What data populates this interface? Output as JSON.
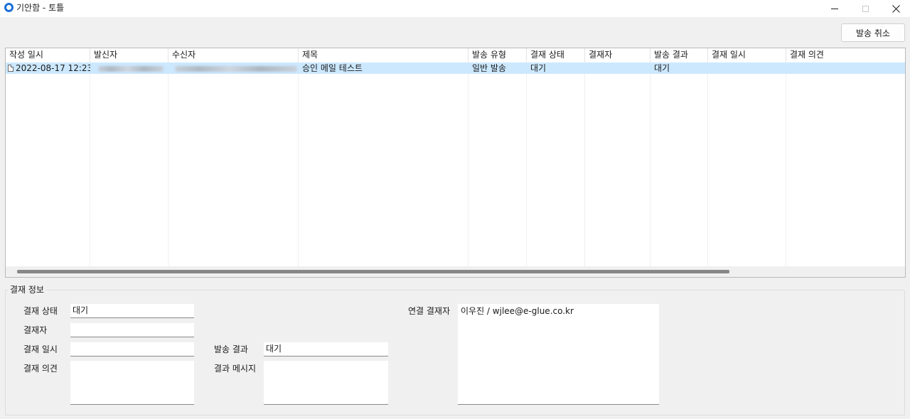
{
  "window": {
    "title": "기안함 - 토틀"
  },
  "toolbar": {
    "cancel_send_label": "발송 취소"
  },
  "list": {
    "columns": [
      "작성 일시",
      "발신자",
      "수신자",
      "제목",
      "발송 유형",
      "결재 상태",
      "결재자",
      "발송 결과",
      "결재 일시",
      "결재 의견"
    ],
    "rows": [
      {
        "created_at": "2022-08-17 12:23",
        "sender": "",
        "recipient": "",
        "subject": "승인 메일 테스트",
        "send_type": "일반 발송",
        "approval_status": "대기",
        "approver": "",
        "send_result": "대기",
        "approval_date": "",
        "approval_comment": ""
      }
    ]
  },
  "approval_info": {
    "group_title": "결재 정보",
    "status_label": "결재 상태",
    "status_value": "대기",
    "approver_label": "결재자",
    "approver_value": "",
    "date_label": "결재 일시",
    "date_value": "",
    "comment_label": "결재 의견",
    "comment_value": "",
    "send_result_label": "발송 결과",
    "send_result_value": "대기",
    "result_message_label": "결과 메시지",
    "result_message_value": "",
    "linked_approver_label": "연결 결재자",
    "linked_approver_value": "이우진 / wjlee@e-glue.co.kr"
  }
}
